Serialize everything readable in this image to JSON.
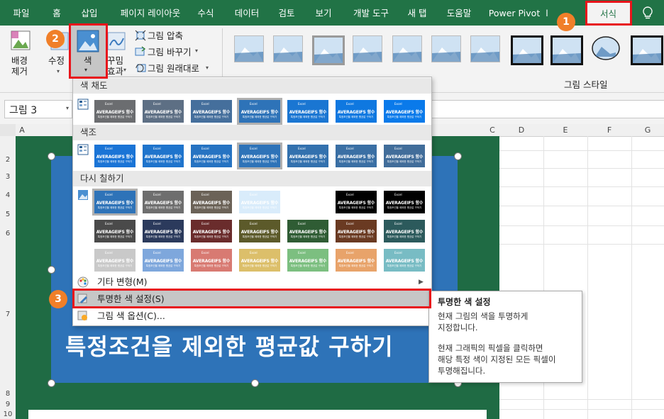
{
  "tabs": [
    "파일",
    "홈",
    "삽입",
    "페이지 레이아웃",
    "수식",
    "데이터",
    "검토",
    "보기",
    "개발 도구",
    "새 탭",
    "도움말",
    "Power Pivot"
  ],
  "active_tab": "서식",
  "ribbon": {
    "remove_bg": "배경\n제거",
    "corrections": "수정",
    "color": "색",
    "artistic": "꾸밈\n효과",
    "compress": "그림 압축",
    "change": "그림 바꾸기",
    "reset": "그림 원래대로",
    "styles_group": "그림 스타일"
  },
  "namebox": "그림 3",
  "columns": [
    "A",
    "C",
    "D",
    "E",
    "F",
    "G"
  ],
  "rows": [
    "2",
    "3",
    "4",
    "5",
    "6",
    "7",
    "8",
    "9",
    "10"
  ],
  "picture_title": "특정조건을 제외한 평균값 구하기",
  "dropdown": {
    "saturation_header": "색 채도",
    "tone_header": "색조",
    "recolor_header": "다시 칠하기",
    "swatch_title": "AVERAGEIFS 함수",
    "swatch_sub": "특정조건을 제외한 평균값 구하기",
    "swatch_logo": "Excel",
    "more_variations": "기타 변형(M)",
    "set_transparent": "투명한 색 설정(S)",
    "color_options": "그림 색 옵션(C)..."
  },
  "tooltip": {
    "title": "투명한 색 설정",
    "line1": "현재 그림의 색을 투명하게",
    "line2": "지정합니다.",
    "line3": "현재 그래픽의 픽셀을 클릭하면",
    "line4": "해당 특정 색이 지정된 모든 픽셀이",
    "line5": "투명해집니다."
  },
  "badges": [
    "1",
    "2",
    "3"
  ],
  "colors": {
    "excel_green": "#217346",
    "highlight_red": "#e8141b",
    "badge_orange": "#f07f29",
    "picture_blue": "#2e73b8"
  }
}
